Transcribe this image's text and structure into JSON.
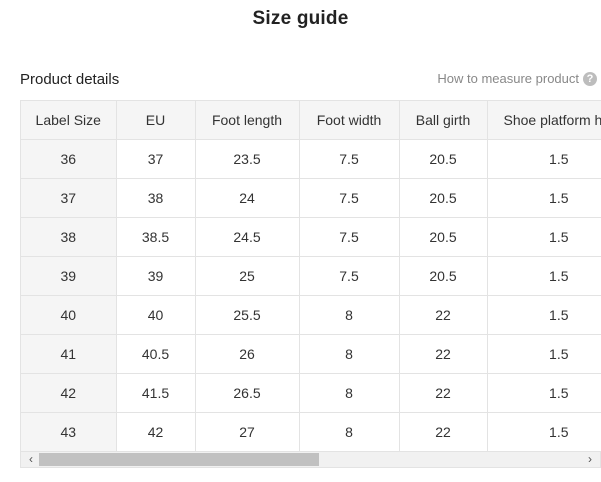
{
  "page": {
    "title": "Size guide"
  },
  "section": {
    "label": "Product details",
    "measure_link": "How to measure product",
    "help_icon": "?"
  },
  "table": {
    "headers": [
      "Label Size",
      "EU",
      "Foot length",
      "Foot width",
      "Ball girth",
      "Shoe platform h"
    ],
    "rows": [
      [
        "36",
        "37",
        "23.5",
        "7.5",
        "20.5",
        "1.5"
      ],
      [
        "37",
        "38",
        "24",
        "7.5",
        "20.5",
        "1.5"
      ],
      [
        "38",
        "38.5",
        "24.5",
        "7.5",
        "20.5",
        "1.5"
      ],
      [
        "39",
        "39",
        "25",
        "7.5",
        "20.5",
        "1.5"
      ],
      [
        "40",
        "40",
        "25.5",
        "8",
        "22",
        "1.5"
      ],
      [
        "41",
        "40.5",
        "26",
        "8",
        "22",
        "1.5"
      ],
      [
        "42",
        "41.5",
        "26.5",
        "8",
        "22",
        "1.5"
      ],
      [
        "43",
        "42",
        "27",
        "8",
        "22",
        "1.5"
      ]
    ]
  },
  "scrollbar": {
    "left_arrow": "‹",
    "right_arrow": "›",
    "scroll_position": 0
  }
}
